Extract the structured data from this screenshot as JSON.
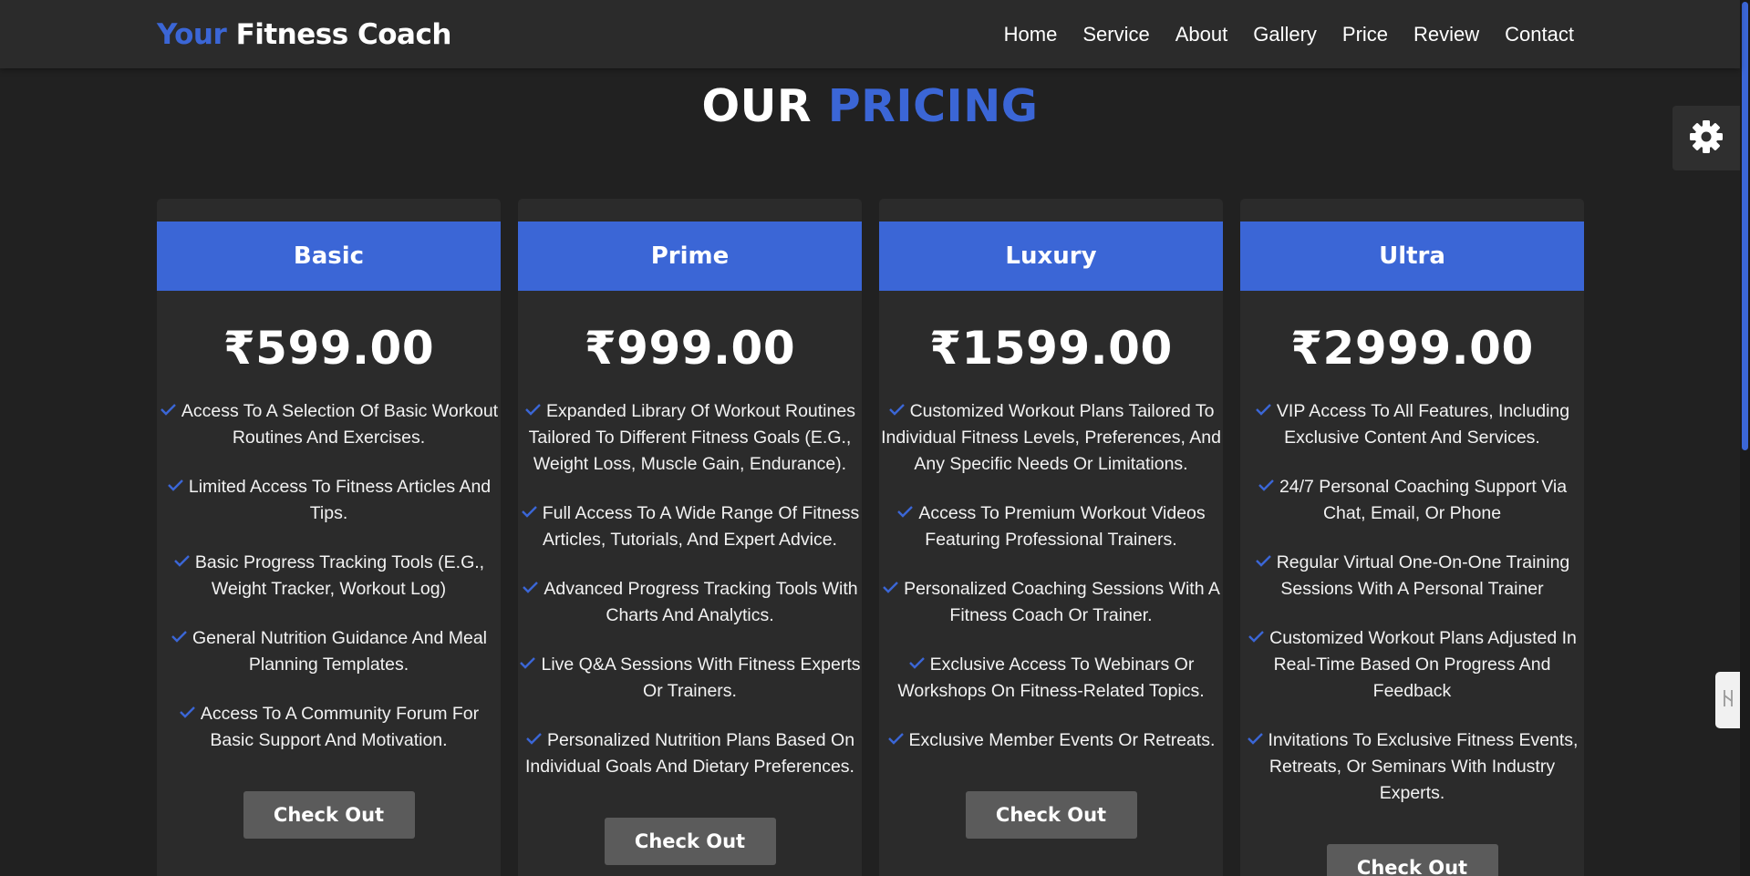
{
  "brand": {
    "accent": "Your",
    "name": "Fitness Coach"
  },
  "nav": [
    "Home",
    "Service",
    "About",
    "Gallery",
    "Price",
    "Review",
    "Contact"
  ],
  "section": {
    "title_plain": "OUR",
    "title_accent": "PRICING"
  },
  "colors": {
    "accent": "#3b66d6",
    "background": "#212121",
    "card": "#2b2b2b",
    "button": "#5b5b5b"
  },
  "icons": {
    "settings": "gear-icon",
    "feature": "check-icon",
    "side_tab": "swap-icon"
  },
  "plans": [
    {
      "name": "Basic",
      "price": "₹599.00",
      "features": [
        "Access To A Selection Of Basic Workout Routines And Exercises.",
        "Limited Access To Fitness Articles And Tips.",
        "Basic Progress Tracking Tools (E.G., Weight Tracker, Workout Log)",
        "General Nutrition Guidance And Meal Planning Templates.",
        "Access To A Community Forum For Basic Support And Motivation."
      ],
      "button": "Check Out"
    },
    {
      "name": "Prime",
      "price": "₹999.00",
      "features": [
        "Expanded Library Of Workout Routines Tailored To Different Fitness Goals (E.G., Weight Loss, Muscle Gain, Endurance).",
        "Full Access To A Wide Range Of Fitness Articles, Tutorials, And Expert Advice.",
        "Advanced Progress Tracking Tools With Charts And Analytics.",
        "Live Q&A Sessions With Fitness Experts Or Trainers.",
        "Personalized Nutrition Plans Based On Individual Goals And Dietary Preferences."
      ],
      "button": "Check Out"
    },
    {
      "name": "Luxury",
      "price": "₹1599.00",
      "features": [
        "Customized Workout Plans Tailored To Individual Fitness Levels, Preferences, And Any Specific Needs Or Limitations.",
        "Access To Premium Workout Videos Featuring Professional Trainers.",
        "Personalized Coaching Sessions With A Fitness Coach Or Trainer.",
        "Exclusive Access To Webinars Or Workshops On Fitness-Related Topics.",
        "Exclusive Member Events Or Retreats."
      ],
      "button": "Check Out"
    },
    {
      "name": "Ultra",
      "price": "₹2999.00",
      "features": [
        "VIP Access To All Features, Including Exclusive Content And Services.",
        "24/7 Personal Coaching Support Via Chat, Email, Or Phone",
        "Regular Virtual One-On-One Training Sessions With A Personal Trainer",
        "Customized Workout Plans Adjusted In Real-Time Based On Progress And Feedback",
        "Invitations To Exclusive Fitness Events, Retreats, Or Seminars With Industry Experts."
      ],
      "button": "Check Out"
    }
  ]
}
